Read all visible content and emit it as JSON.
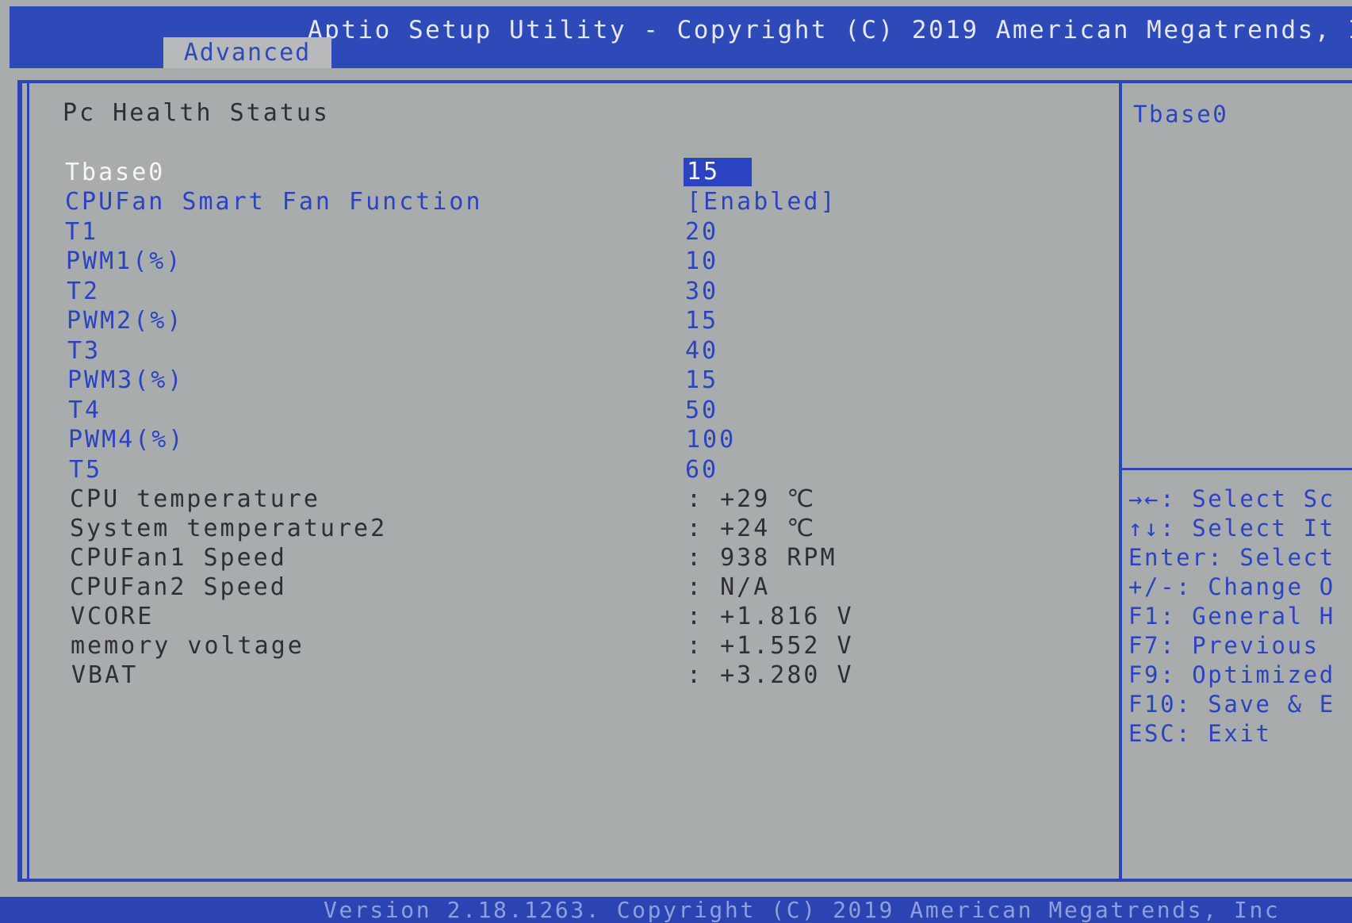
{
  "header": {
    "title": "Aptio Setup Utility - Copyright (C) 2019 American Megatrends, I",
    "tab": "Advanced"
  },
  "page": {
    "title": "Pc Health Status"
  },
  "settings": [
    {
      "label": "Tbase0",
      "value": "15"
    },
    {
      "label": "CPUFan Smart Fan Function",
      "value": "[Enabled]"
    },
    {
      "label": "T1",
      "value": "20"
    },
    {
      "label": "PWM1(%)",
      "value": "10"
    },
    {
      "label": "T2",
      "value": "30"
    },
    {
      "label": "PWM2(%)",
      "value": "15"
    },
    {
      "label": "T3",
      "value": "40"
    },
    {
      "label": "PWM3(%)",
      "value": "15"
    },
    {
      "label": "T4",
      "value": "50"
    },
    {
      "label": "PWM4(%)",
      "value": "100"
    },
    {
      "label": "T5",
      "value": "60"
    }
  ],
  "readings": [
    {
      "label": "CPU temperature",
      "value": ": +29 ℃"
    },
    {
      "label": "System temperature2",
      "value": ": +24 ℃"
    },
    {
      "label": "CPUFan1 Speed",
      "value": ": 938 RPM"
    },
    {
      "label": "CPUFan2 Speed",
      "value": ": N/A"
    },
    {
      "label": "VCORE",
      "value": ": +1.816 V"
    },
    {
      "label": "memory voltage",
      "value": ": +1.552 V"
    },
    {
      "label": "VBAT",
      "value": ": +3.280 V"
    }
  ],
  "help": {
    "title": "Tbase0",
    "keys": [
      "→←: Select Sc",
      "↑↓: Select It",
      "Enter: Select",
      "+/-: Change O",
      "F1: General H",
      "F7: Previous",
      "F9: Optimized",
      "F10: Save & E",
      "ESC: Exit"
    ]
  },
  "footer": {
    "version": "Version 2.18.1263. Copyright (C) 2019 American Megatrends, Inc"
  },
  "colors": {
    "bios_blue": "#2b43c0",
    "panel_gray": "#a9acad",
    "highlight_text": "#f4f6f8"
  }
}
